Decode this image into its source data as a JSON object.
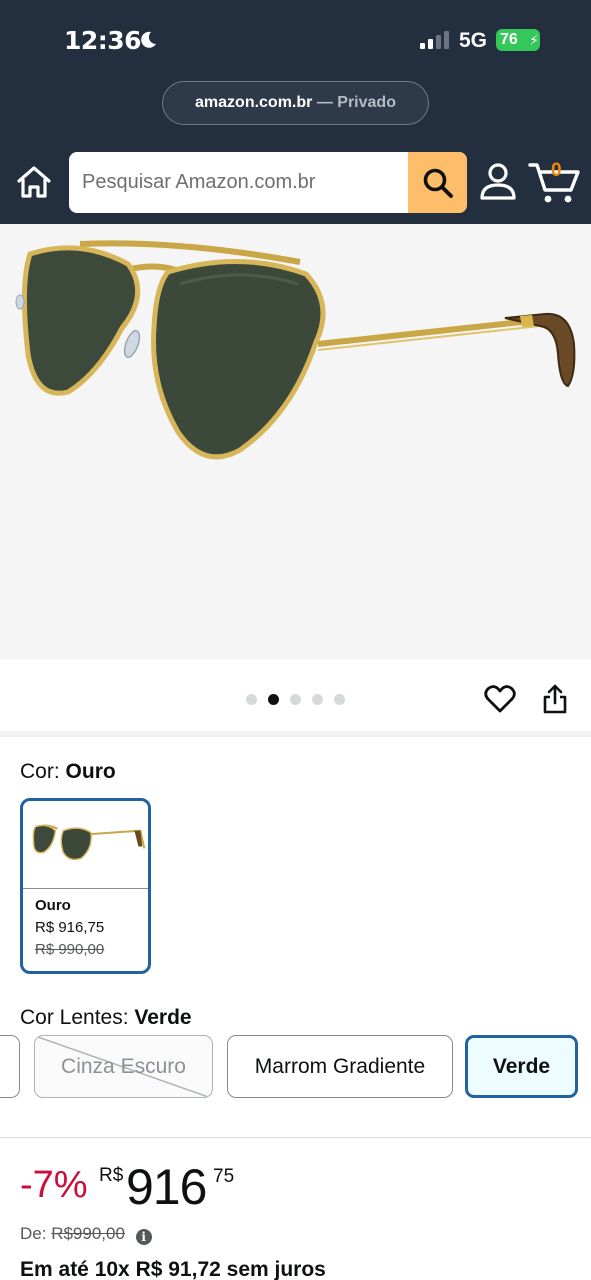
{
  "status_bar": {
    "time": "12:36",
    "network": "5G",
    "battery": "76"
  },
  "browser": {
    "url": "amazon.com.br",
    "private_label": "— Privado"
  },
  "header": {
    "search_placeholder": "Pesquisar Amazon.com.br",
    "cart_count": "0"
  },
  "gallery": {
    "image_count": 5,
    "active_index": 1
  },
  "color": {
    "label": "Cor:",
    "selected": "Ouro",
    "options": [
      {
        "name": "Ouro",
        "price": "R$ 916,75",
        "old_price": "R$ 990,00"
      }
    ]
  },
  "lens": {
    "label": "Cor Lentes:",
    "selected": "Verde",
    "options": [
      {
        "label": "Cinza Escuro",
        "state": "unavailable"
      },
      {
        "label": "Marrom Gradiente",
        "state": "available"
      },
      {
        "label": "Verde",
        "state": "selected"
      }
    ]
  },
  "price": {
    "discount": "-7%",
    "currency": "R$",
    "whole": "916",
    "fraction": "75",
    "list_label": "De:",
    "list_value": "R$990,00",
    "installments": "Em até 10x R$ 91,72 sem juros"
  },
  "colors": {
    "header_bg": "#232f3e",
    "search_button": "#febd69",
    "accent_blue": "#2162a1",
    "discount_red": "#cc0c39",
    "cart_orange": "#f08804"
  }
}
